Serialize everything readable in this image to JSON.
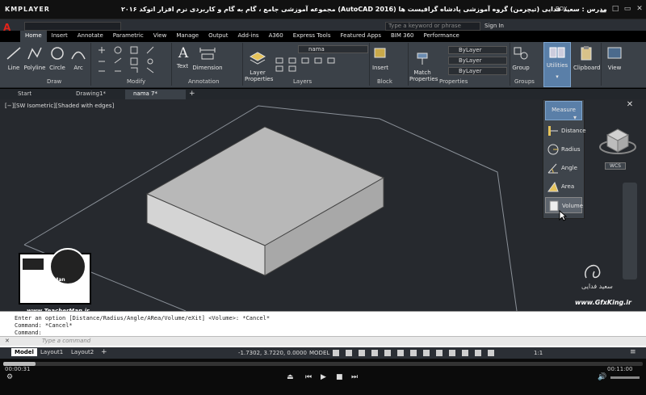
{
  "player": {
    "logo": "KMPLAYER",
    "title": "مجموعه آموزشی جامع ، گام به گام و کاربردی نرم افزار  اتوکد ۲۰۱۶ (AutoCAD 2016)  مدرس : سعید فدایی (تیچرمن) گروه آموزشی پادشاه گرافیست ها",
    "box_label": "BOX",
    "time_elapsed": "00:00:31",
    "time_total": "00:11:00",
    "progress": 0.05
  },
  "acad": {
    "logo": "A",
    "search_placeholder": "Type a keyword or phrase",
    "sign_in": "Sign In"
  },
  "ribbon_tabs": [
    "Home",
    "Insert",
    "Annotate",
    "Parametric",
    "View",
    "Manage",
    "Output",
    "Add-ins",
    "A360",
    "Express Tools",
    "Featured Apps",
    "BIM 360",
    "Performance"
  ],
  "ribbon": {
    "draw": {
      "label": "Draw",
      "tools": [
        "Line",
        "Polyline",
        "Circle",
        "Arc"
      ]
    },
    "modify": {
      "label": "Modify"
    },
    "annotation": {
      "label": "Annotation",
      "tools": [
        "Text",
        "Dimension"
      ]
    },
    "layers": {
      "label": "Layers",
      "properties": "Layer Properties",
      "current": "nama"
    },
    "block": {
      "label": "Block",
      "insert": "Insert"
    },
    "properties": {
      "label": "Properties",
      "match": "Match Properties",
      "bylayer": "ByLayer"
    },
    "groups": {
      "label": "Groups",
      "group": "Group"
    },
    "utilities": {
      "label": "Utilities"
    },
    "clipboard": {
      "label": "Clipboard"
    },
    "view": {
      "label": "View"
    }
  },
  "file_tabs": [
    "Start",
    "Drawing1*",
    "nama 7*"
  ],
  "viewport_label": "[−][SW Isometric][Shaded with edges]",
  "measure": {
    "label": "Measure",
    "items": [
      "Distance",
      "Radius",
      "Angle",
      "Area",
      "Volume"
    ],
    "selected": "Volume"
  },
  "viewcube": {
    "wcs": "WCS"
  },
  "command": {
    "lines": [
      "Enter an option [Distance/Radius/Angle/ARea/Volume/eXit] <Volume>: *Cancel*",
      "Command: *Cancel*",
      "Command:"
    ],
    "placeholder": "Type a command"
  },
  "layout_tabs": [
    "Model",
    "Layout1",
    "Layout2"
  ],
  "status": {
    "coords": "-1.7302, 3.7220, 0.0000",
    "model": "MODEL",
    "scale": "1:1"
  },
  "watermarks": {
    "site_left": "www.TeacherMan.ir",
    "teacher": "Teacher Man",
    "site_right": "www.GfxKing.ir",
    "signature": "سعید فدایی"
  }
}
